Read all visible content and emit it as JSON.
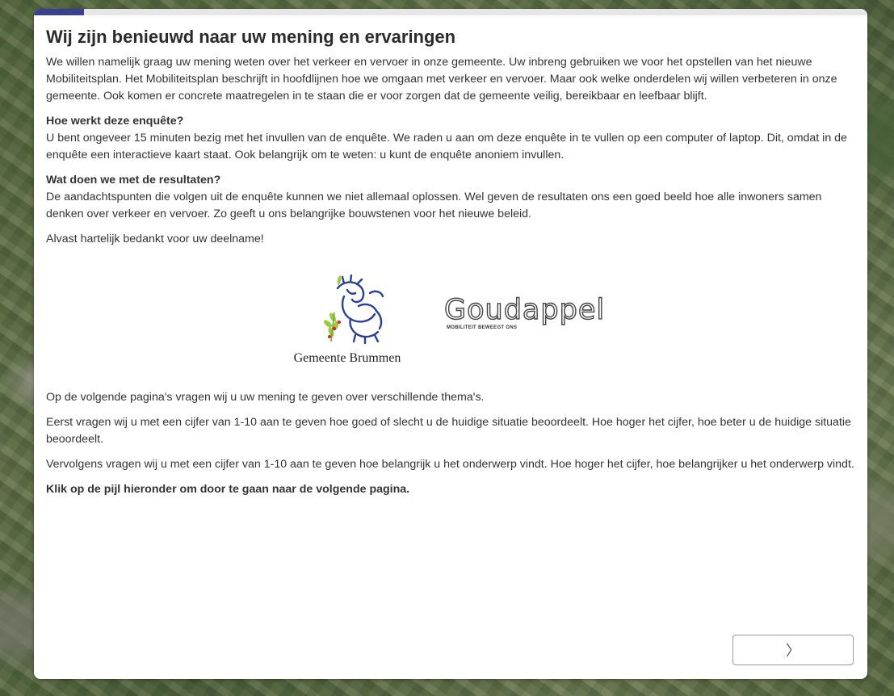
{
  "progress": {
    "fraction": 0.06,
    "color": "#3b3f8f"
  },
  "page": {
    "title": "Wij zijn benieuwd naar uw mening en ervaringen",
    "intro": "We willen namelijk graag uw mening weten over het verkeer en vervoer in onze gemeente. Uw inbreng gebruiken we voor het opstellen van het nieuwe Mobiliteitsplan. Het Mobiliteitsplan beschrijft in hoofdlijnen hoe we omgaan met verkeer en vervoer. Maar ook welke onderdelen wij willen verbeteren in onze gemeente. Ook komen er concrete maatregelen in te staan die er voor zorgen dat de gemeente veilig, bereikbaar en leefbaar blijft.",
    "section1_title": "Hoe werkt deze enquête?",
    "section1_text": "U bent ongeveer 15 minuten bezig met het invullen van de enquête. We raden u aan om deze enquête in te vullen op een computer of laptop. Dit, omdat in de enquête een interactieve kaart staat. Ook belangrijk om te weten: u kunt de enquête anoniem invullen.",
    "section2_title": "Wat doen we met de resultaten?",
    "section2_text": "De aandachtspunten die volgen uit de enquête kunnen we niet allemaal oplossen. Wel geven de resultaten ons een goed beeld hoe alle inwoners samen denken over verkeer en vervoer. Zo geeft u ons belangrijke bouwstenen voor het nieuwe beleid.",
    "thanks": "Alvast hartelijk bedankt voor uw deelname!",
    "next_pages": "Op de volgende pagina's vragen wij u uw mening te geven over verschillende thema's.",
    "rating_current": "Eerst vragen wij u met een cijfer van 1-10 aan te geven hoe goed of slecht u de huidige situatie beoordeelt. Hoe hoger het cijfer, hoe beter u de huidige situatie beoordeelt.",
    "rating_importance": "Vervolgens vragen wij u met een cijfer van 1-10 aan te geven hoe belangrijk u het onderwerp vindt. Hoe hoger het cijfer, hoe belangrijker u het onderwerp vindt.",
    "click_instruction": "Klik op de pijl hieronder om door te gaan naar de volgende pagina."
  },
  "logos": {
    "brummen_name": "Gemeente Brummen",
    "goudappel_name": "Goudappel",
    "goudappel_tagline": "MOBILITEIT BEWEEGT ONS"
  },
  "navigation": {
    "next_icon": "chevron-right-icon",
    "next_glyph": "〉"
  }
}
